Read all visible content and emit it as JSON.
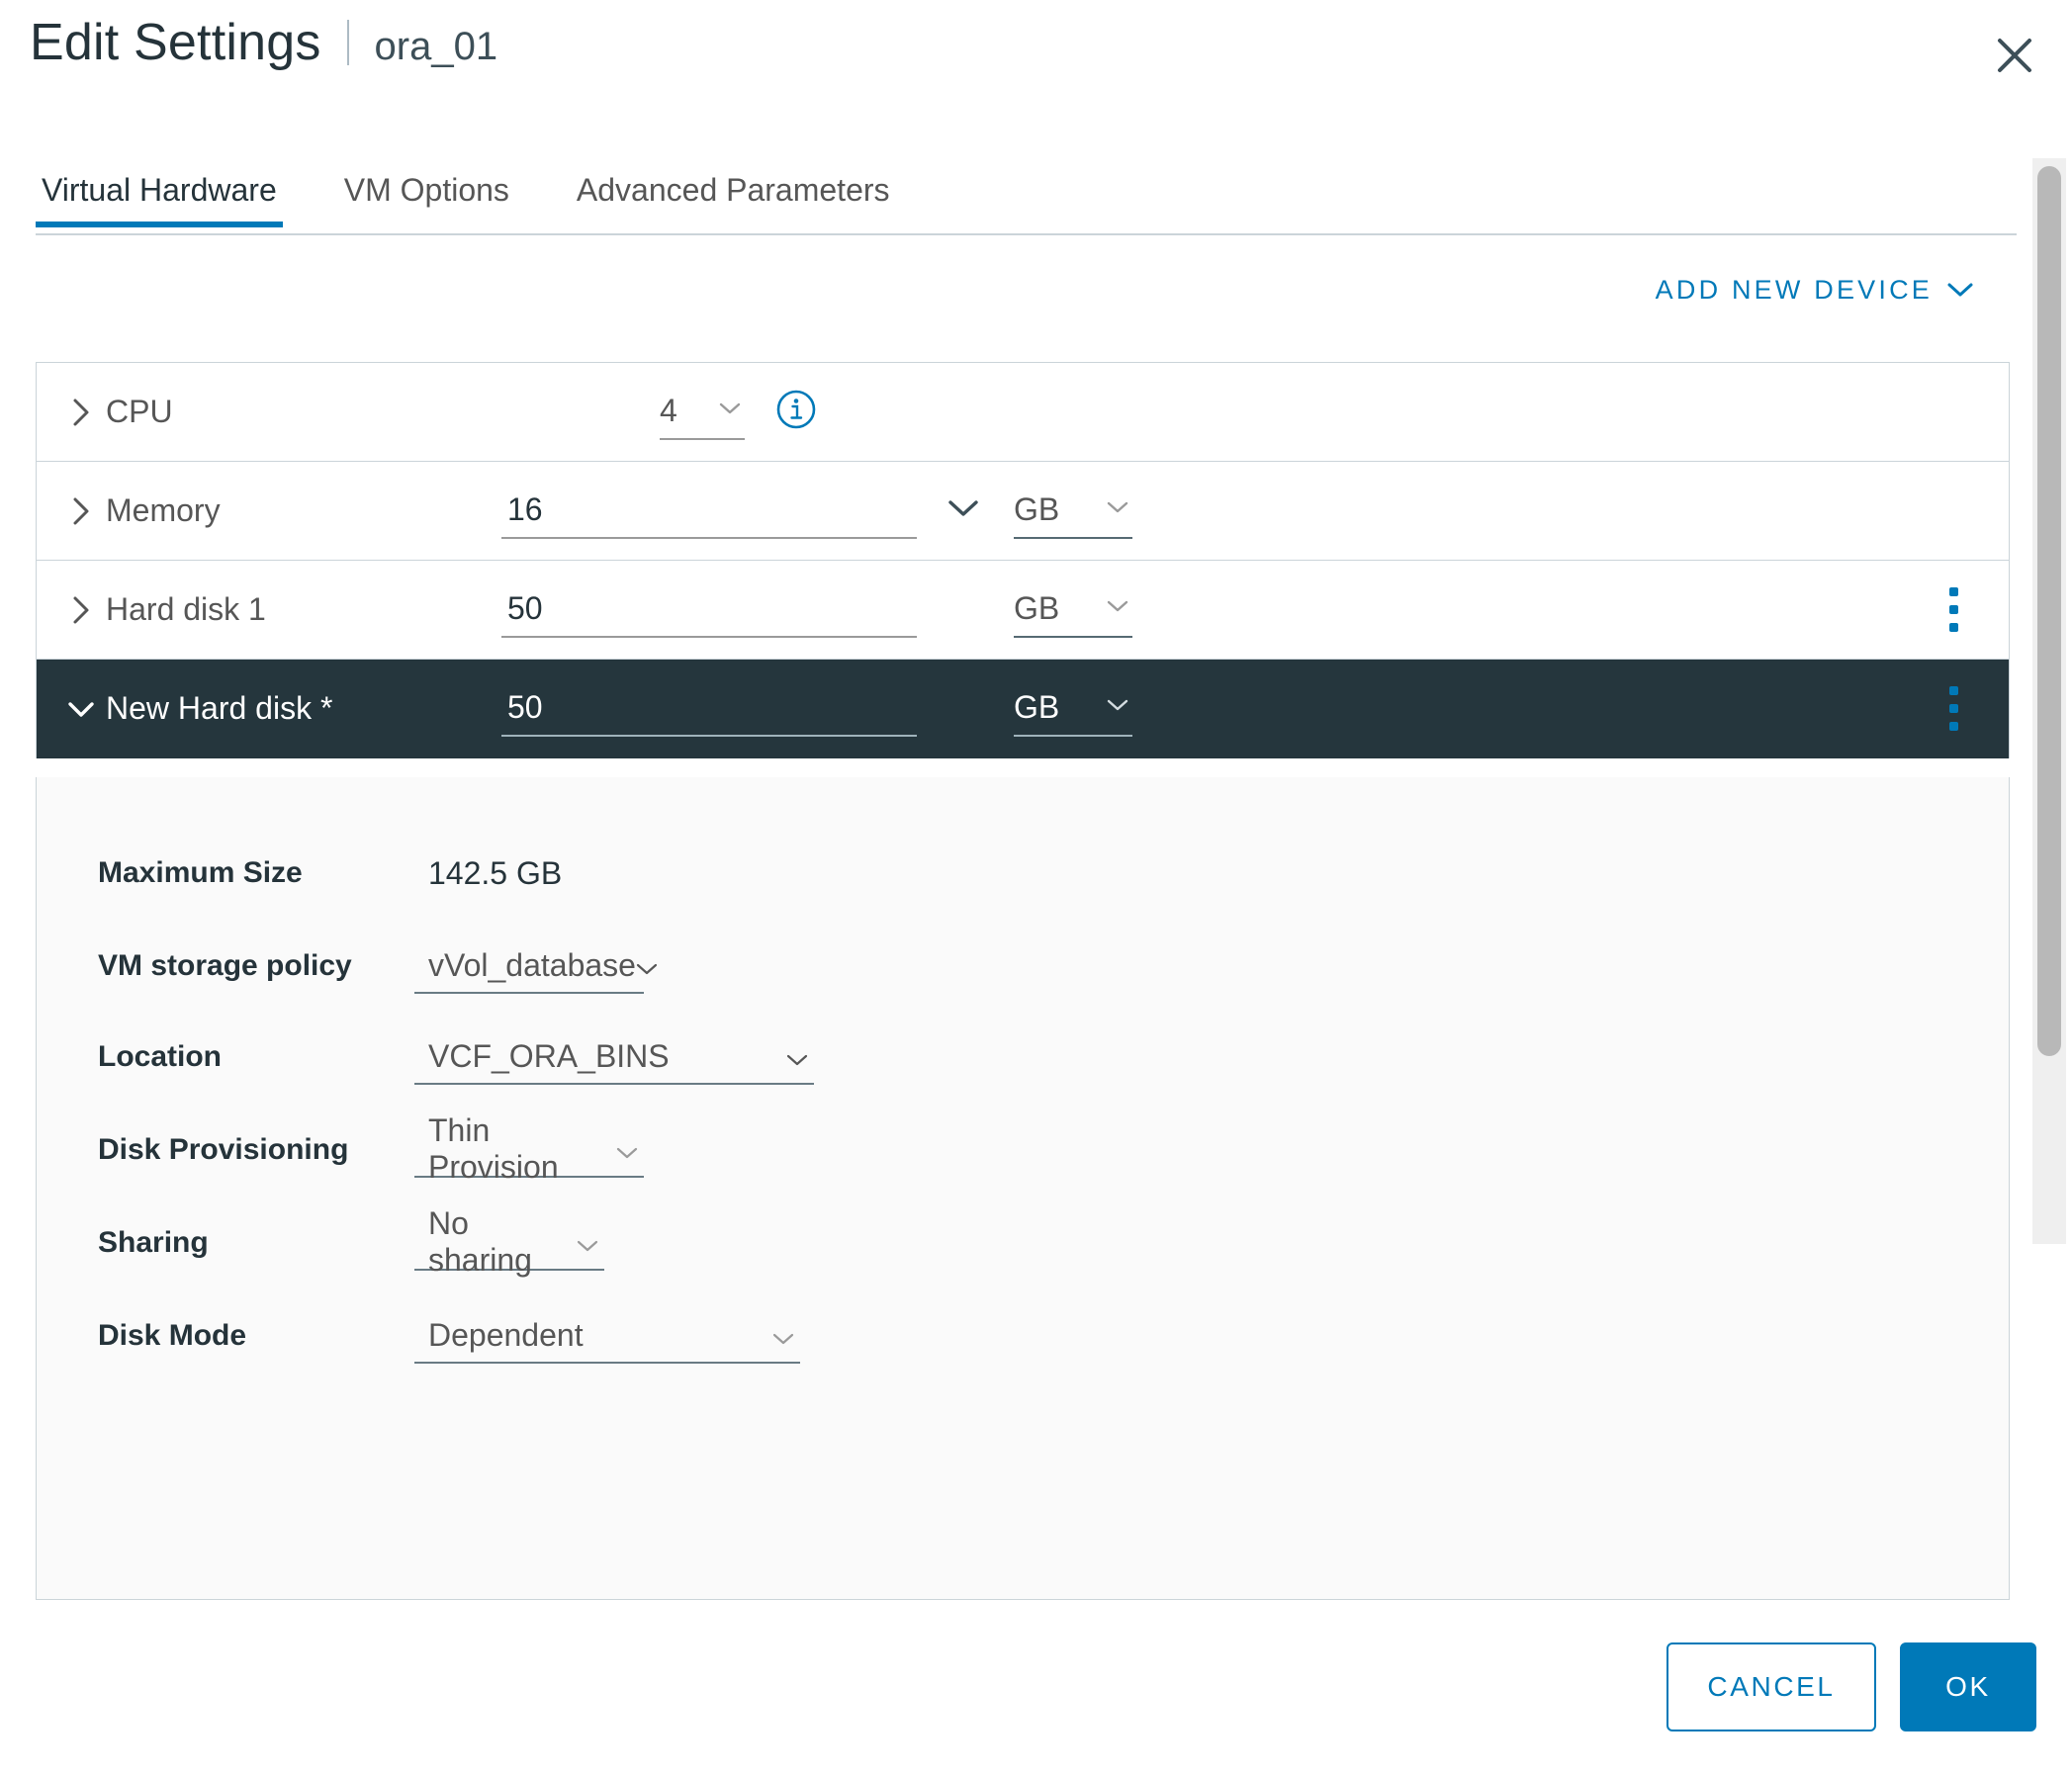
{
  "header": {
    "title": "Edit Settings",
    "separator": "|",
    "vm_name": "ora_01",
    "close_icon": "close-icon"
  },
  "tabs": [
    {
      "label": "Virtual Hardware",
      "active": true
    },
    {
      "label": "VM Options",
      "active": false
    },
    {
      "label": "Advanced Parameters",
      "active": false
    }
  ],
  "toolbar": {
    "add_device_label": "ADD NEW DEVICE",
    "add_device_caret": "chevron-down-icon"
  },
  "devices": [
    {
      "name": "CPU",
      "expanded": false,
      "caret": "chevron-right-icon",
      "value": "4",
      "value_caret": "chevron-down-icon",
      "info_icon": "info-circle-icon",
      "unit": null,
      "kebab": false
    },
    {
      "name": "Memory",
      "expanded": false,
      "caret": "chevron-right-icon",
      "value": "16",
      "value_caret": "chevron-down-icon",
      "unit": "GB",
      "unit_caret": "chevron-down-icon",
      "kebab": false
    },
    {
      "name": "Hard disk 1",
      "expanded": false,
      "caret": "chevron-right-icon",
      "value": "50",
      "unit": "GB",
      "unit_caret": "chevron-down-icon",
      "kebab": true
    },
    {
      "name": "New Hard disk *",
      "expanded": true,
      "selected": true,
      "caret": "chevron-down-icon",
      "value": "50",
      "unit": "GB",
      "unit_caret": "chevron-down-icon",
      "kebab": true
    }
  ],
  "disk_details": [
    {
      "label": "Maximum Size",
      "value": "142.5 GB",
      "type": "text"
    },
    {
      "label": "VM storage policy",
      "value": "vVol_database",
      "type": "select"
    },
    {
      "label": "Location",
      "value": "VCF_ORA_BINS",
      "type": "select"
    },
    {
      "label": "Disk Provisioning",
      "value": "Thin Provision",
      "type": "select"
    },
    {
      "label": "Sharing",
      "value": "No sharing",
      "type": "select"
    },
    {
      "label": "Disk Mode",
      "value": "Dependent",
      "type": "select"
    }
  ],
  "footer": {
    "cancel_label": "CANCEL",
    "ok_label": "OK"
  },
  "colors": {
    "accent": "#0079b8",
    "selected_row": "#25363d",
    "text": "#25333a",
    "muted_text": "#565656",
    "border": "#cbd4d9",
    "panel_bg": "#fafafa"
  }
}
